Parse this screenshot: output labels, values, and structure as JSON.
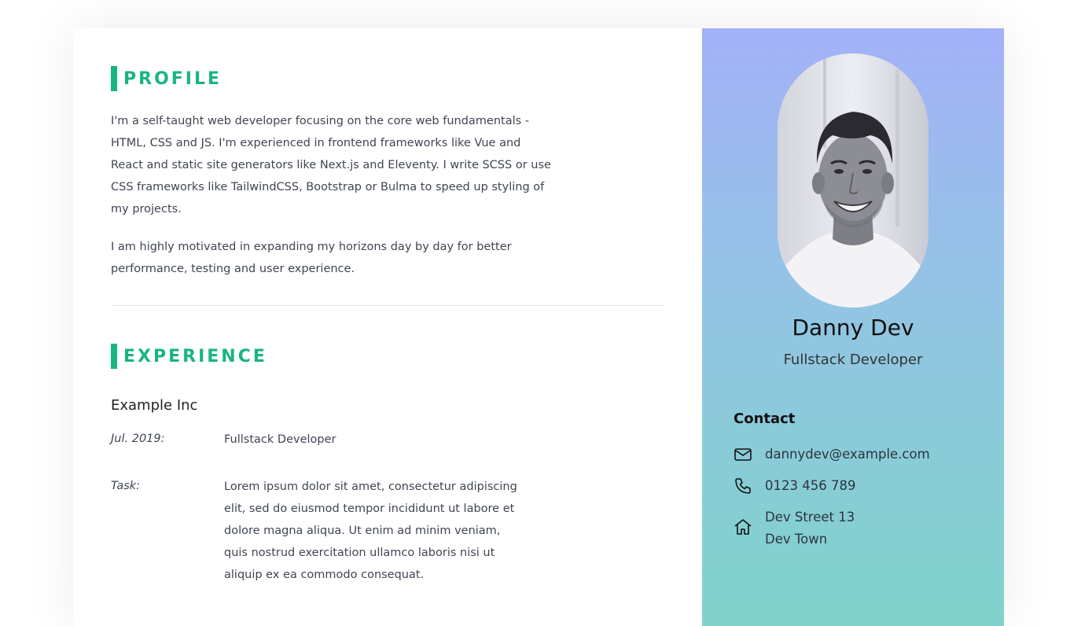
{
  "profile": {
    "heading": "PROFILE",
    "paragraph1": "I'm a self-taught web developer focusing on the core web fundamentals - HTML, CSS and JS. I'm experienced in frontend frameworks like Vue and React and static site generators like Next.js and Eleventy. I write SCSS or use CSS frameworks like TailwindCSS, Bootstrap or Bulma to speed up styling of my projects.",
    "paragraph2": "I am highly motivated in expanding my horizons day by day for better performance, testing and user experience."
  },
  "experience": {
    "heading": "EXPERIENCE",
    "company": "Example Inc",
    "date_label": "Jul. 2019:",
    "date_value": "Fullstack Developer",
    "task_label": "Task:",
    "task_value": "Lorem ipsum dolor sit amet, consectetur adipiscing elit, sed do eiusmod tempor incididunt ut labore et dolore magna aliqua. Ut enim ad minim veniam, quis nostrud exercitation ullamco laboris nisi ut aliquip ex ea commodo consequat."
  },
  "sidebar": {
    "name": "Danny Dev",
    "role": "Fullstack Developer",
    "contact_heading": "Contact",
    "email": "dannydev@example.com",
    "phone": "0123 456 789",
    "address_line1": "Dev Street 13",
    "address_line2": "Dev Town",
    "icons": [
      "mail-icon",
      "phone-icon",
      "home-icon"
    ]
  },
  "colors": {
    "accent": "#18b57e",
    "sidebar_top": "#a3b1f8",
    "sidebar_bottom": "#7fd3ca"
  }
}
